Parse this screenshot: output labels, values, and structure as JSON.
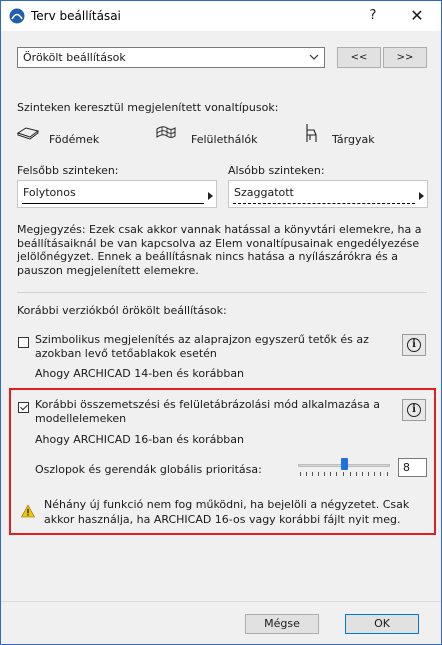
{
  "window": {
    "title": "Terv beállításai",
    "help_label": "?",
    "close_label": "✕"
  },
  "preset": {
    "selected": "Örökölt beállítások",
    "prev_label": "<<",
    "next_label": ">>"
  },
  "linetypes": {
    "heading": "Szinteken keresztül megjelenített vonaltípusok:",
    "items": [
      {
        "label": "Födémek",
        "icon": "slab-icon"
      },
      {
        "label": "Felülethálók",
        "icon": "mesh-icon"
      },
      {
        "label": "Tárgyak",
        "icon": "chair-icon"
      }
    ],
    "upper": {
      "label": "Felsőbb szinteken:",
      "value": "Folytonos"
    },
    "lower": {
      "label": "Alsóbb szinteken:",
      "value": "Szaggatott"
    },
    "note": "Megjegyzés: Ezek csak akkor vannak hatással a könyvtári elemekre, ha a beállításaiknál be van kapcsolva az Elem vonaltípusainak engedélyezése jelölőnégyzet. Ennek a beállításnak nincs hatása a nyílászárókra és a pauszon megjelenített elemekre."
  },
  "legacy": {
    "heading": "Korábbi verziókból örökölt beállítások:",
    "option1": {
      "label": "Szimbolikus megjelenítés az alaprajzon egyszerű tetők és az azokban levő tetőablakok esetén",
      "checked": false,
      "sub": "Ahogy ARCHICAD 14-ben és korábban"
    },
    "option2": {
      "label": "Korábbi összemetszési és felületábrázolási mód alkalmazása a modellelemeken",
      "checked": true,
      "sub": "Ahogy ARCHICAD 16-ban és korábban",
      "priority_label": "Oszlopok és gerendák globális prioritása:",
      "priority_value": "8",
      "priority_fraction": 0.5,
      "warning": "Néhány új funkció nem fog működni, ha bejelöli a négyzetet. Csak akkor használja, ha ARCHICAD 16-os vagy korábbi fájlt nyit meg."
    }
  },
  "footer": {
    "cancel_label": "Mégse",
    "ok_label": "OK"
  },
  "colors": {
    "accent": "#1e73e0",
    "highlight_border": "#e02020",
    "warning": "#f5c400"
  }
}
